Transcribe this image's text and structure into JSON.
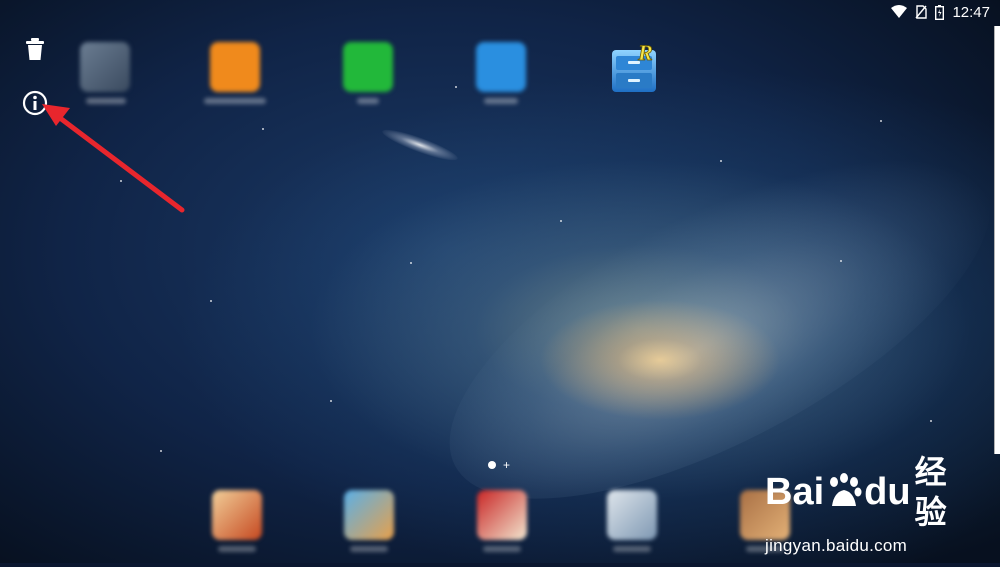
{
  "status_bar": {
    "time": "12:47",
    "icons": [
      "wifi-icon",
      "no-sim-icon",
      "battery-icon"
    ]
  },
  "tools": [
    "trash-icon",
    "info-icon"
  ],
  "home_apps": [
    "blurred-app",
    "orange-app",
    "wechat-app",
    "blue-app",
    "file-explorer-app"
  ],
  "dock_apps": [
    "game-app-1",
    "game-app-2",
    "game-app-3",
    "game-app-4",
    "game-app-5"
  ],
  "annotation": {
    "arrow_color": "#e8262d"
  },
  "watermark": {
    "brand_part1": "Bai",
    "brand_part2": "du",
    "brand_cn": "经验",
    "url": "jingyan.baidu.com"
  },
  "colors": {
    "orange_app": "#f08a1c",
    "wechat_app": "#22b83a",
    "blue_app": "#2a8fe0"
  }
}
